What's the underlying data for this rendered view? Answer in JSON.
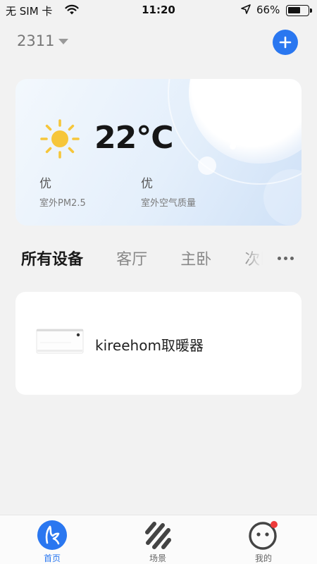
{
  "status_bar": {
    "carrier": "无 SIM 卡",
    "time": "11:20",
    "battery_percent": "66%",
    "battery_level": 0.66
  },
  "header": {
    "home_name": "2311",
    "add_icon": "plus-icon"
  },
  "weather": {
    "icon": "sun-icon",
    "temperature": "22°C",
    "pm25": {
      "value": "优",
      "label": "室外PM2.5"
    },
    "air_quality": {
      "value": "优",
      "label": "室外空气质量"
    }
  },
  "tabs": [
    {
      "label": "所有设备",
      "active": true
    },
    {
      "label": "客厅",
      "active": false
    },
    {
      "label": "主卧",
      "active": false
    },
    {
      "label": "次卧",
      "active": false
    }
  ],
  "devices": [
    {
      "name": "kireehom取暖器",
      "icon": "heater-icon"
    }
  ],
  "bottom_nav": [
    {
      "label": "首页",
      "icon": "home-icon",
      "active": true
    },
    {
      "label": "场景",
      "icon": "scene-icon",
      "active": false
    },
    {
      "label": "我的",
      "icon": "profile-icon",
      "active": false
    }
  ],
  "colors": {
    "accent": "#2a77f0",
    "background": "#f2f2f2",
    "sun": "#f6c63a",
    "badge": "#ee3a3a"
  }
}
